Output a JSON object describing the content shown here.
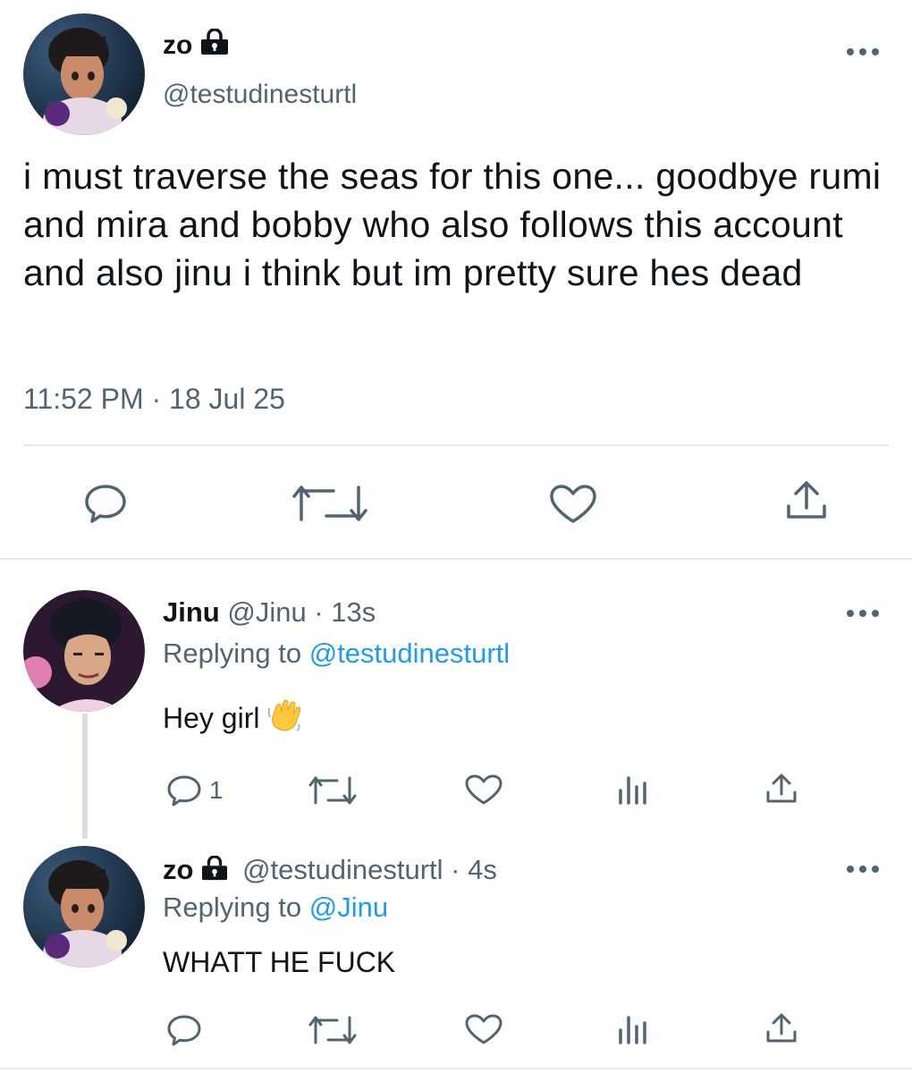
{
  "main_tweet": {
    "display_name": "zo",
    "protected_icon": "lock-icon",
    "handle": "@testudinesturtl",
    "text": "i must traverse the seas for this one... goodbye rumi and mira and bobby who also follows this account and also jinu i think but im pretty sure hes dead",
    "timestamp": "11:52 PM · 18 Jul 25",
    "actions": [
      "reply-icon",
      "retweet-icon",
      "like-icon",
      "share-icon"
    ]
  },
  "replies": [
    {
      "display_name": "Jinu",
      "handle": "@Jinu",
      "time": "· 13s",
      "replying_label": "Replying to",
      "replying_handle": "@testudinesturtl",
      "text": "Hey girl",
      "emoji": "👋",
      "reply_count": "1",
      "actions": [
        "reply-icon",
        "retweet-icon",
        "like-icon",
        "analytics-icon",
        "share-icon"
      ]
    },
    {
      "display_name": "zo",
      "protected_icon": "lock-icon",
      "handle": "@testudinesturtl",
      "time": "· 4s",
      "replying_label": "Replying to",
      "replying_handle": "@Jinu",
      "text": "WHATT HE FUCK",
      "actions": [
        "reply-icon",
        "retweet-icon",
        "like-icon",
        "analytics-icon",
        "share-icon"
      ]
    }
  ],
  "colors": {
    "text": "#0f1419",
    "secondary": "#536471",
    "link": "#1d9bf0",
    "divider": "#e6e9ec"
  }
}
